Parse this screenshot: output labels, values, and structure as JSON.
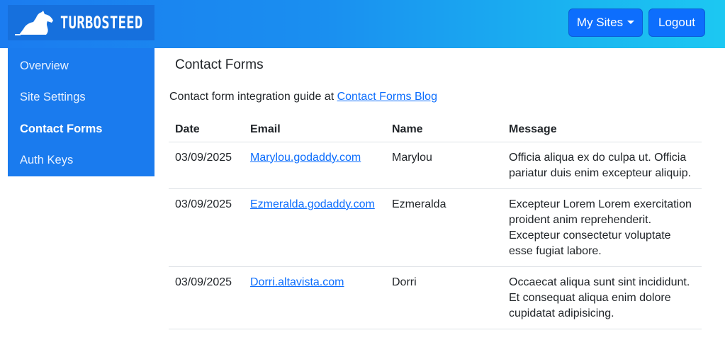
{
  "brand": {
    "name": "TURBOSTEED"
  },
  "header": {
    "sites_label": "My Sites",
    "logout_label": "Logout"
  },
  "sidebar": {
    "items": [
      {
        "label": "Overview",
        "active": false
      },
      {
        "label": "Site Settings",
        "active": false
      },
      {
        "label": "Contact Forms",
        "active": true
      },
      {
        "label": "Auth Keys",
        "active": false
      }
    ]
  },
  "main": {
    "title": "Contact Forms",
    "guide_text": "Contact form integration guide at ",
    "guide_link": "Contact Forms Blog"
  },
  "table": {
    "columns": [
      "Date",
      "Email",
      "Name",
      "Message"
    ],
    "rows": [
      {
        "date": "03/09/2025",
        "email": "Marylou.godaddy.com",
        "name": "Marylou",
        "message": "Officia aliqua ex do culpa ut. Officia pariatur duis enim excepteur aliquip."
      },
      {
        "date": "03/09/2025",
        "email": "Ezmeralda.godaddy.com",
        "name": "Ezmeralda",
        "message": "Excepteur Lorem Lorem exercitation proident anim reprehenderit. Excepteur consectetur voluptate esse fugiat labore."
      },
      {
        "date": "03/09/2025",
        "email": "Dorri.altavista.com",
        "name": "Dorri",
        "message": "Occaecat aliqua sunt sint incididunt. Et consequat aliqua enim dolore cupidatat adipisicing."
      }
    ]
  },
  "colors": {
    "primary": "#0d6efd",
    "sidebar": "#1a7bee",
    "header_start": "#1b7cf0",
    "header_end": "#1cc8f2"
  }
}
